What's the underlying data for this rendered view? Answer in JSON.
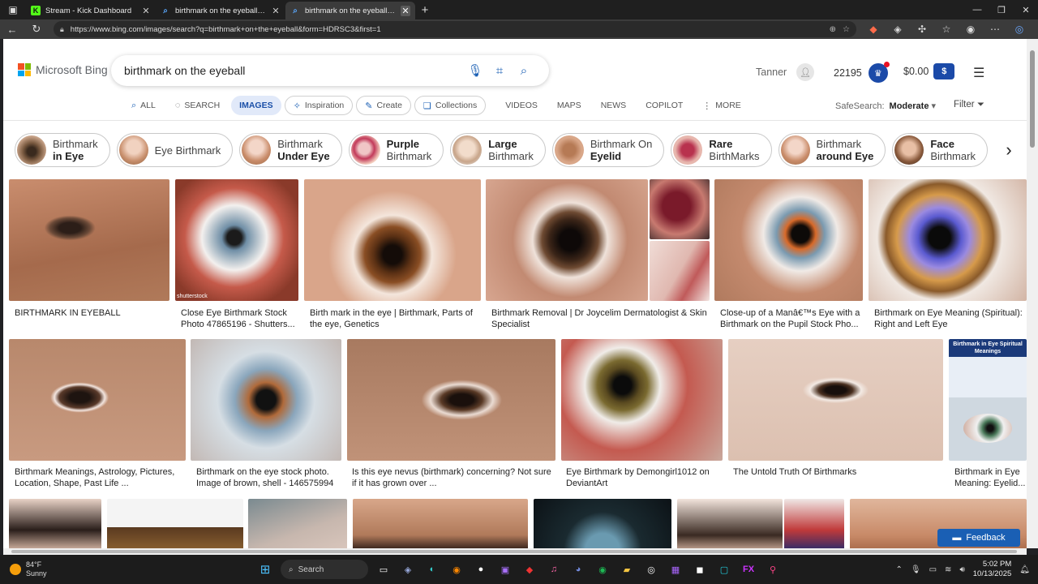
{
  "browser": {
    "tabs": [
      {
        "title": "Stream - Kick Dashboard",
        "favicon": "kick-icon",
        "active": false
      },
      {
        "title": "birthmark on the eyeball - Search",
        "favicon": "bing-icon",
        "active": false
      },
      {
        "title": "birthmark on the eyeball - Search",
        "favicon": "bing-icon",
        "active": true
      }
    ],
    "url": "https://www.bing.com/images/search?q=birthmark+on+the+eyeball&form=HDRSC3&first=1"
  },
  "header": {
    "logo_text": "Microsoft Bing",
    "query": "birthmark on the eyeball",
    "user_name": "Tanner",
    "points": "22195",
    "wallet": "$0.00"
  },
  "nav": {
    "tabs": [
      {
        "label": "ALL",
        "icon": "search-icon"
      },
      {
        "label": "SEARCH",
        "icon": "copilot-icon"
      },
      {
        "label": "IMAGES",
        "icon": "",
        "active": true
      },
      {
        "label": "Inspiration",
        "icon": "inspiration-icon"
      },
      {
        "label": "Create",
        "icon": "create-icon"
      },
      {
        "label": "Collections",
        "icon": "collections-icon"
      },
      {
        "label": "VIDEOS",
        "icon": ""
      },
      {
        "label": "MAPS",
        "icon": ""
      },
      {
        "label": "NEWS",
        "icon": ""
      },
      {
        "label": "COPILOT",
        "icon": ""
      },
      {
        "label": "MORE",
        "icon": "more-icon"
      }
    ],
    "safesearch_label": "SafeSearch:",
    "safesearch_value": "Moderate",
    "filter_label": "Filter"
  },
  "chips": [
    {
      "line1": "Birthmark",
      "line2": "in Eye",
      "bold": 2
    },
    {
      "line1": "Eye Birthmark",
      "line2": "",
      "bold": 0
    },
    {
      "line1": "Birthmark",
      "line2": "Under Eye",
      "bold": 2
    },
    {
      "line1": "Purple",
      "line2": "Birthmark",
      "bold": 1
    },
    {
      "line1": "Large",
      "line2": "Birthmark",
      "bold": 1
    },
    {
      "line1": "Birthmark On",
      "line2": "Eyelid",
      "bold": 2
    },
    {
      "line1": "Rare",
      "line2": "BirthMarks",
      "bold": 1
    },
    {
      "line1": "Birthmark",
      "line2": "around Eye",
      "bold": 2
    },
    {
      "line1": "Face",
      "line2": "Birthmark",
      "bold": 1
    }
  ],
  "results_row1": [
    "BIRTHMARK IN EYEBALL",
    "Close Eye Birthmark Stock Photo 47865196 - Shutters...",
    "Birth mark in the eye | Birthmark, Parts of the eye, Genetics",
    "Birthmark Removal | Dr Joycelim Dermatologist & Skin Specialist",
    "Close-up of a Manâ€™s Eye with a Birthmark on the Pupil Stock Pho...",
    "Birthmark on Eye Meaning (Spiritual): Right and Left Eye"
  ],
  "results_row2": [
    "Birthmark Meanings, Astrology, Pictures, Location, Shape, Past Life ...",
    "Birthmark on the eye stock photo. Image of brown, shell - 146575994",
    "Is this eye nevus (birthmark) concerning? Not sure if it has grown over ...",
    "Eye Birthmark by Demongirl1012 on DeviantArt",
    "The Untold Truth Of Birthmarks",
    "Birthmark in Eye Meaning: Eyelid..."
  ],
  "thumb_texts": {
    "shutterstock": "shutterstock",
    "spiritual_title": "Birthmark in Eye Spiritual Meanings"
  },
  "feedback_label": "Feedback",
  "taskbar": {
    "temp": "84°F",
    "condition": "Sunny",
    "search_label": "Search",
    "time": "5:02 PM",
    "date": "10/13/2025"
  }
}
